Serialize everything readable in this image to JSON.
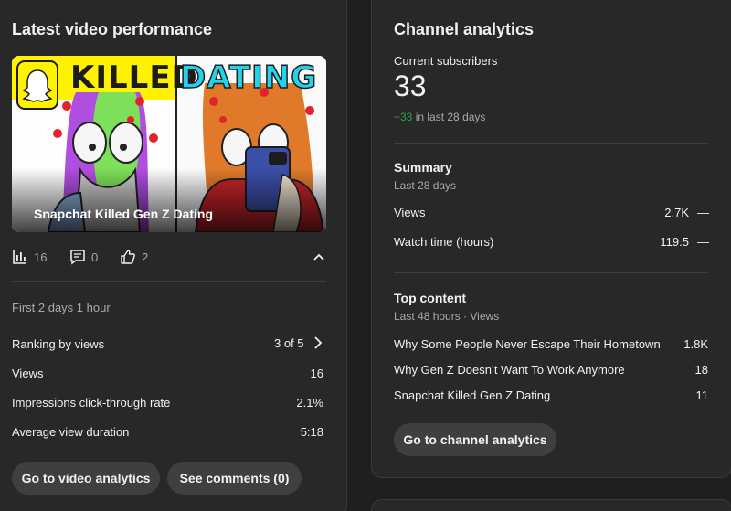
{
  "latest": {
    "title": "Latest video performance",
    "video_title": "Snapchat Killed Gen Z Dating",
    "thumb_word_1": "KILLED",
    "thumb_word_2": "DATING",
    "stats": {
      "views": "16",
      "comments": "0",
      "likes": "2"
    },
    "period": "First 2 days 1 hour",
    "rows": [
      {
        "label": "Ranking by views",
        "value": "3 of 5"
      },
      {
        "label": "Views",
        "value": "16"
      },
      {
        "label": "Impressions click-through rate",
        "value": "2.1%"
      },
      {
        "label": "Average view duration",
        "value": "5:18"
      }
    ],
    "buttons": {
      "video_analytics": "Go to video analytics",
      "see_comments": "See comments (0)"
    }
  },
  "channel": {
    "title": "Channel analytics",
    "subs_label": "Current subscribers",
    "subs_value": "33",
    "subs_change": "+33",
    "subs_change_suffix": "in last 28 days",
    "summary": {
      "title": "Summary",
      "period": "Last 28 days",
      "rows": [
        {
          "label": "Views",
          "value": "2.7K",
          "trend": "—"
        },
        {
          "label": "Watch time (hours)",
          "value": "119.5",
          "trend": "—"
        }
      ]
    },
    "top_content": {
      "title": "Top content",
      "period": "Last 48 hours · Views",
      "rows": [
        {
          "label": "Why Some People Never Escape Their Hometown",
          "value": "1.8K"
        },
        {
          "label": "Why Gen Z Doesn’t Want To Work Anymore",
          "value": "18"
        },
        {
          "label": "Snapchat Killed Gen Z Dating",
          "value": "11"
        }
      ]
    },
    "button": "Go to channel analytics"
  },
  "colors": {
    "positive": "#2ba640",
    "card": "#282828",
    "pill": "#3f3f3f"
  }
}
